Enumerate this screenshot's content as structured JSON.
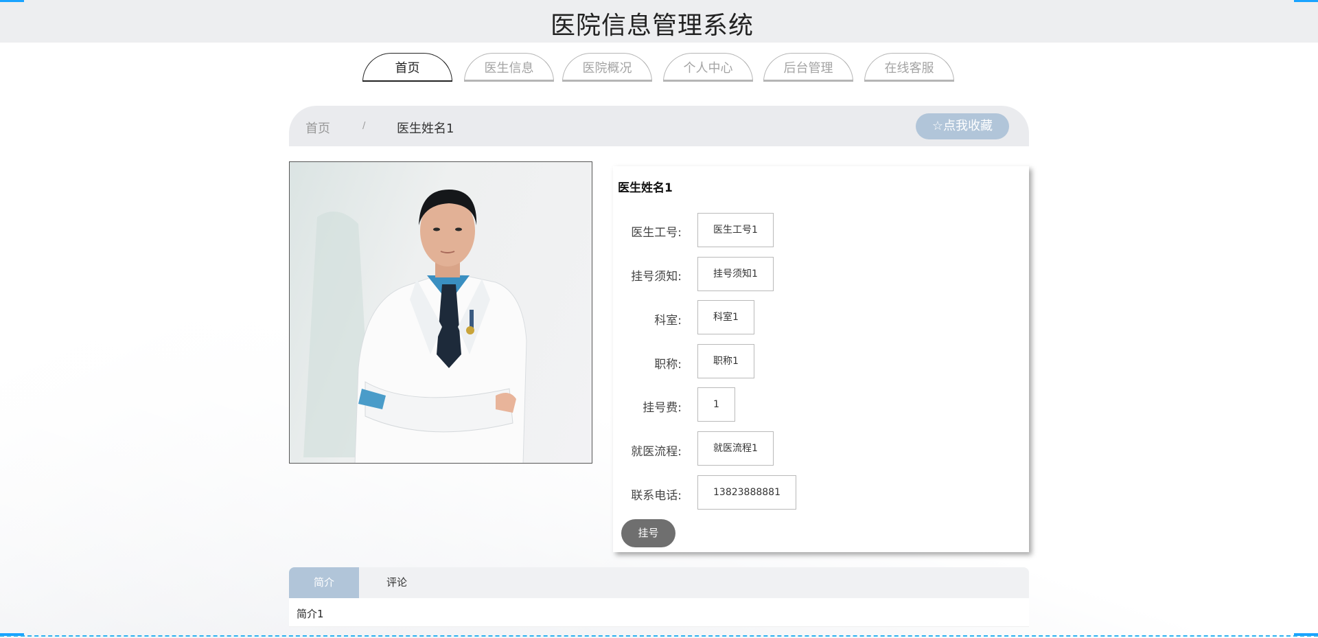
{
  "site": {
    "title": "医院信息管理系统"
  },
  "nav": {
    "items": [
      {
        "label": "首页",
        "active": true
      },
      {
        "label": "医生信息",
        "active": false
      },
      {
        "label": "医院概况",
        "active": false
      },
      {
        "label": "个人中心",
        "active": false
      },
      {
        "label": "后台管理",
        "active": false
      },
      {
        "label": "在线客服",
        "active": false
      }
    ]
  },
  "breadcrumb": {
    "home": "首页",
    "separator": "/",
    "current": "医生姓名1"
  },
  "favorite": {
    "icon": "star-outline-icon",
    "label": "点我收藏"
  },
  "doctor": {
    "name": "医生姓名1",
    "fields": [
      {
        "label": "医生工号:",
        "value": "医生工号1"
      },
      {
        "label": "挂号须知:",
        "value": "挂号须知1"
      },
      {
        "label": "科室:",
        "value": "科室1"
      },
      {
        "label": "职称:",
        "value": "职称1"
      },
      {
        "label": "挂号费:",
        "value": "1"
      },
      {
        "label": "就医流程:",
        "value": "就医流程1"
      },
      {
        "label": "联系电话:",
        "value": "13823888881"
      }
    ],
    "register_label": "挂号"
  },
  "tabs": {
    "items": [
      {
        "label": "简介",
        "active": true
      },
      {
        "label": "评论",
        "active": false
      }
    ],
    "content": "简介1"
  },
  "colors": {
    "accent": "#b1c5d9",
    "corner": "#1aa3ff",
    "register_button": "#6f6f6f"
  }
}
